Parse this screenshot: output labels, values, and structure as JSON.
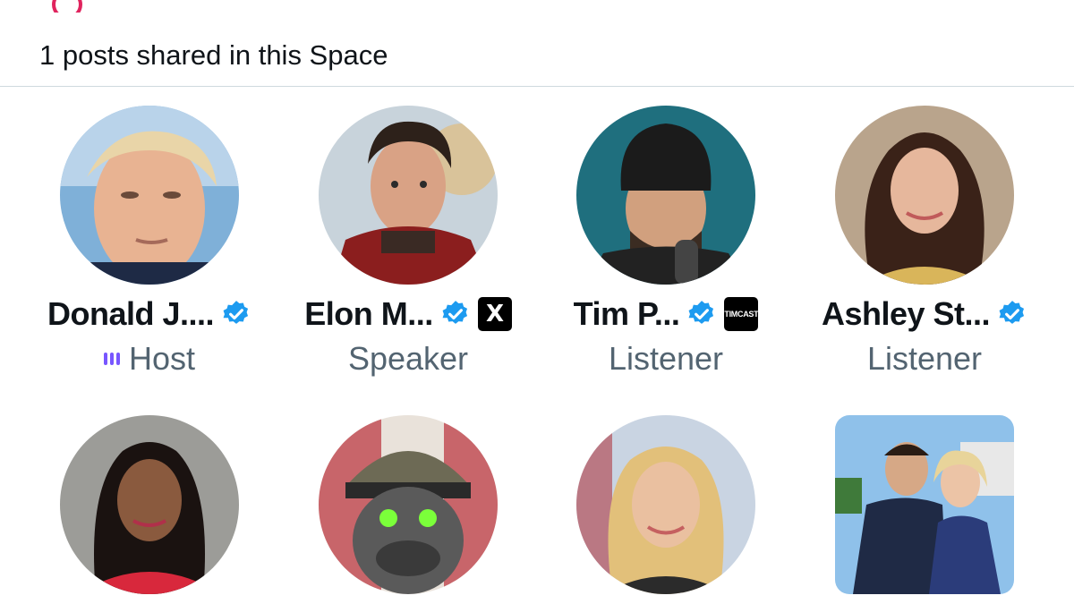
{
  "header": {
    "posts_shared": "1 posts shared in this Space"
  },
  "participants": [
    {
      "name": "Donald J....",
      "role": "Host",
      "verified": true,
      "affiliation": "",
      "avatar": "trump-avatar"
    },
    {
      "name": "Elon M...",
      "role": "Speaker",
      "verified": true,
      "affiliation": "X",
      "avatar": "elon-avatar"
    },
    {
      "name": "Tim P...",
      "role": "Listener",
      "verified": true,
      "affiliation": "TIMCAST",
      "avatar": "tim-avatar"
    },
    {
      "name": "Ashley St...",
      "role": "Listener",
      "verified": true,
      "affiliation": "",
      "avatar": "ashley-avatar"
    }
  ],
  "colors": {
    "verified": "#1d9bf0",
    "host_indicator": "#7856ff",
    "role_text": "#536471",
    "divider": "#cfd9de"
  },
  "icons": {
    "verified": "verified-badge-icon",
    "host": "audio-bars-icon",
    "x_logo": "x-logo-icon"
  }
}
